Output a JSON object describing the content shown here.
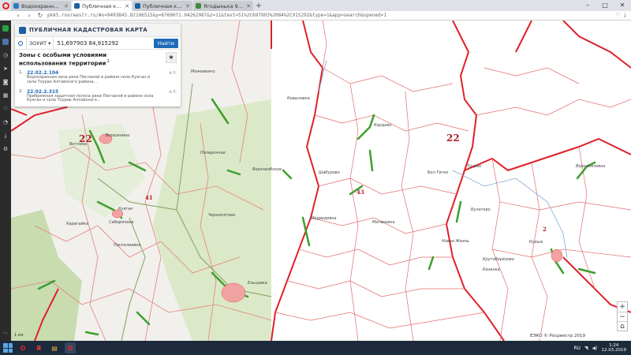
{
  "browser": {
    "tabs": [
      {
        "title": "Водоохранная зона – Ст",
        "favicon_color": "#2a7ac8",
        "active": false
      },
      {
        "title": "Публичная кадастрова",
        "favicon_color": "#1b5fa3",
        "active": true
      },
      {
        "title": "Публичная кадастрова",
        "favicon_color": "#1b5fa3",
        "active": false
      },
      {
        "title": "Ягодынька 9 (разговор",
        "favicon_color": "#3b8b3b",
        "active": false
      }
    ],
    "url": "pkk5.rosreestr.ru/#x=9493845.82106515&y=6760071.04262987&z=11&text=51%2C697903%2084%2C915292&type=1&app=search&opened=1",
    "window_controls": [
      "–",
      "□",
      "✕"
    ]
  },
  "sidebar_icons": [
    "whatsapp-icon",
    "vk-icon",
    "clock-icon",
    "send-icon",
    "camera-icon",
    "grid-icon",
    "heart-icon",
    "history-icon",
    "download-icon",
    "settings-icon"
  ],
  "panel": {
    "title": "ПУБЛИЧНАЯ КАДАСТРОВАЯ КАРТА",
    "layer_select": "ЗОУИТ",
    "search_value": "51,697903 84,915292",
    "find_label": "Найти",
    "results_title": "Зоны с особыми условиями использования территории",
    "results_count": "2",
    "results": [
      {
        "num": "1.",
        "code": "22.02.2.104",
        "desc": "Водоохранная зона реки Песчаной в районе села Куяган и села Тоурак Алтайского района..."
      },
      {
        "num": "2.",
        "code": "22.02.2.315",
        "desc": "Прибрежная защитная полоса реки Песчаной в районе села Куяган и села Тоурак Алтайского..."
      }
    ]
  },
  "map": {
    "zone_labels": [
      {
        "text": "22",
        "size": "big"
      },
      {
        "text": "22",
        "size": "big"
      },
      {
        "text": "41",
        "size": "small"
      },
      {
        "text": "43",
        "size": "small"
      },
      {
        "text": "2",
        "size": "small"
      }
    ],
    "places": [
      "Вершинино",
      "Ветлино",
      "Карагайка",
      "Куяган",
      "Сибирячиха",
      "Пантелеевка",
      "Ковыловка",
      "Кардово",
      "Шабурово",
      "Бол.Тигиз",
      "Тоурак",
      "Медведевка",
      "Матвеевка",
      "Новая Жизнь",
      "Булатово",
      "Крутоберёзово",
      "Куяша",
      "Казанка",
      "Верхнеобское",
      "Поперечное",
      "Чернопятово",
      "Межевкино",
      "Верхнеяловка",
      "Ельцовка"
    ],
    "attribution": "ЕЭКО © Росреестр 2019",
    "scale": "1 км",
    "colors": {
      "zone_border": "#e0202a",
      "district_line": "#e26b6b",
      "water_zone": "#3d9e2d",
      "road": "#7a9a5c",
      "forest": "#dbe9c8"
    }
  },
  "zoom": {
    "in": "+",
    "out": "−",
    "home": "⌂"
  },
  "taskbar": {
    "apps": [
      {
        "name": "opera-taskbar-icon",
        "glyph": "O",
        "color": "#e0242b"
      },
      {
        "name": "yandex-taskbar-icon",
        "glyph": "Я",
        "color": "#f33"
      },
      {
        "name": "folder-taskbar-icon",
        "glyph": "▤",
        "color": "#e3b23c"
      },
      {
        "name": "opera-gx-taskbar-icon",
        "glyph": "O",
        "color": "#d62a2a"
      }
    ],
    "lang": "RU",
    "time": "1:24",
    "date": "12.03.2019"
  }
}
